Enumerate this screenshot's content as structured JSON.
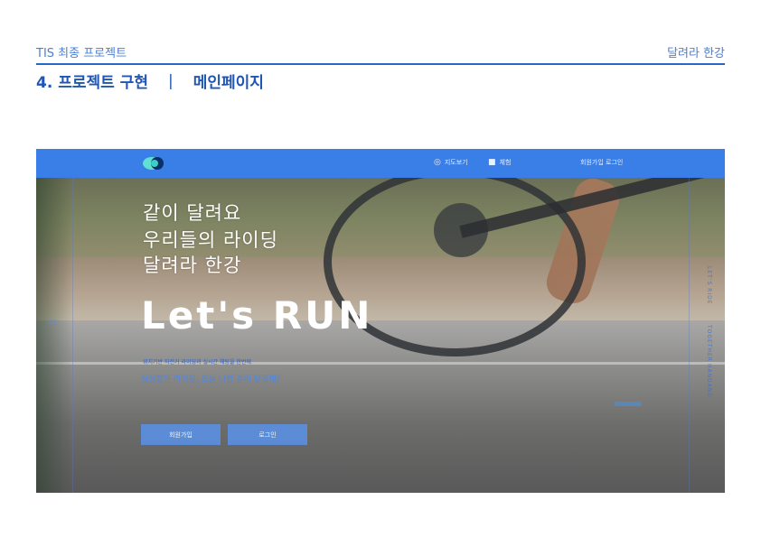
{
  "header": {
    "course": "TIS 최종 프로젝트",
    "project": "달려라 한강",
    "section_number": "4. 프로젝트 구현",
    "separator": "|",
    "section_page": "메인페이지"
  },
  "screenshot": {
    "nav": {
      "map_label": "지도보기",
      "rank_label": "체험",
      "signup_label": "회원가입",
      "login_label": "로그인"
    },
    "hero": {
      "line1": "같이 달려요",
      "line2": "우리들의 라이딩",
      "line3": "달려라 한강",
      "headline": "Let's RUN",
      "desc_small": "위치기반 자전거 라이딩과 실시간 채팅을 한번에",
      "desc_large": "심심했던 라이딩, 오늘 나랑 같이 달릴래?"
    },
    "buttons": {
      "signup": "회원가입",
      "login": "로그인"
    },
    "side": {
      "pager": "01",
      "label_a": "LET'S RIDE",
      "label_b": "TOGETHER",
      "label_c": "HANGANG"
    },
    "colors": {
      "nav_bg": "#3a7ee8",
      "accent": "#2866c7",
      "button_bg": "#5b8fe0"
    }
  }
}
